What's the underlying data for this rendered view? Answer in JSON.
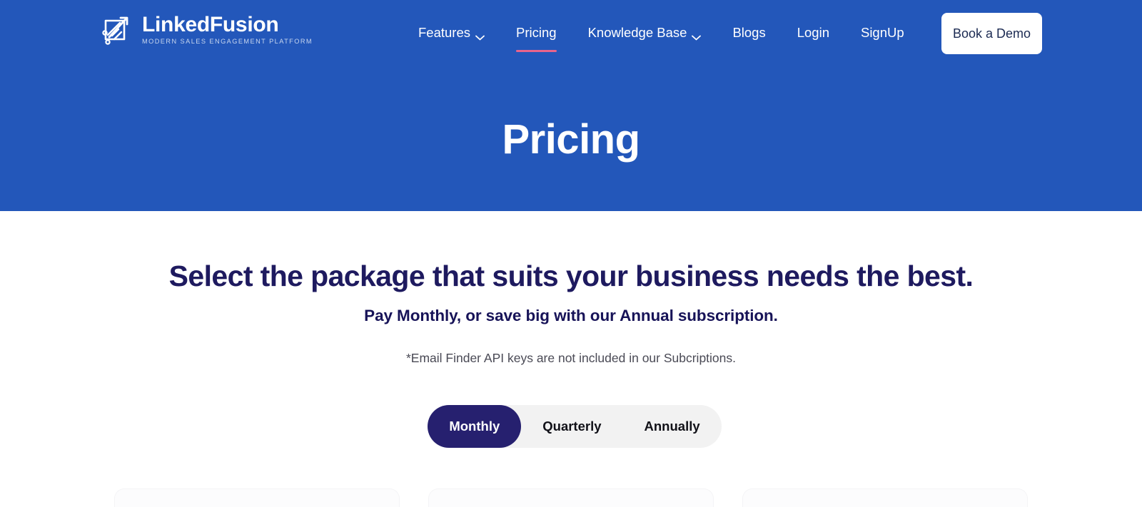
{
  "brand": {
    "name": "LinkedFusion",
    "tagline": "MODERN SALES ENGAGEMENT PLATFORM",
    "icon": "arrow-growth-icon"
  },
  "nav": {
    "items": [
      {
        "label": "Features",
        "has_dropdown": true,
        "active": false
      },
      {
        "label": "Pricing",
        "has_dropdown": false,
        "active": true
      },
      {
        "label": "Knowledge Base",
        "has_dropdown": true,
        "active": false
      },
      {
        "label": "Blogs",
        "has_dropdown": false,
        "active": false
      },
      {
        "label": "Login",
        "has_dropdown": false,
        "active": false
      },
      {
        "label": "SignUp",
        "has_dropdown": false,
        "active": false
      }
    ],
    "cta_label": "Book a Demo"
  },
  "hero": {
    "title": "Pricing"
  },
  "main": {
    "headline": "Select the package that suits your business needs the best.",
    "subheadline": "Pay Monthly, or save big with our Annual subscription.",
    "note": "*Email Finder API keys are not included in our Subcriptions."
  },
  "billing_toggle": {
    "options": [
      {
        "label": "Monthly",
        "active": true
      },
      {
        "label": "Quarterly",
        "active": false
      },
      {
        "label": "Annually",
        "active": false
      }
    ],
    "selected": "Monthly"
  },
  "colors": {
    "hero_blue": "#2357ba",
    "headline_navy": "#1e1a5f",
    "active_pill_navy": "#26206f",
    "active_nav_underline_pink": "#e8648c",
    "toggle_track_gray": "#f2f2f2",
    "cta_white": "#ffffff"
  }
}
